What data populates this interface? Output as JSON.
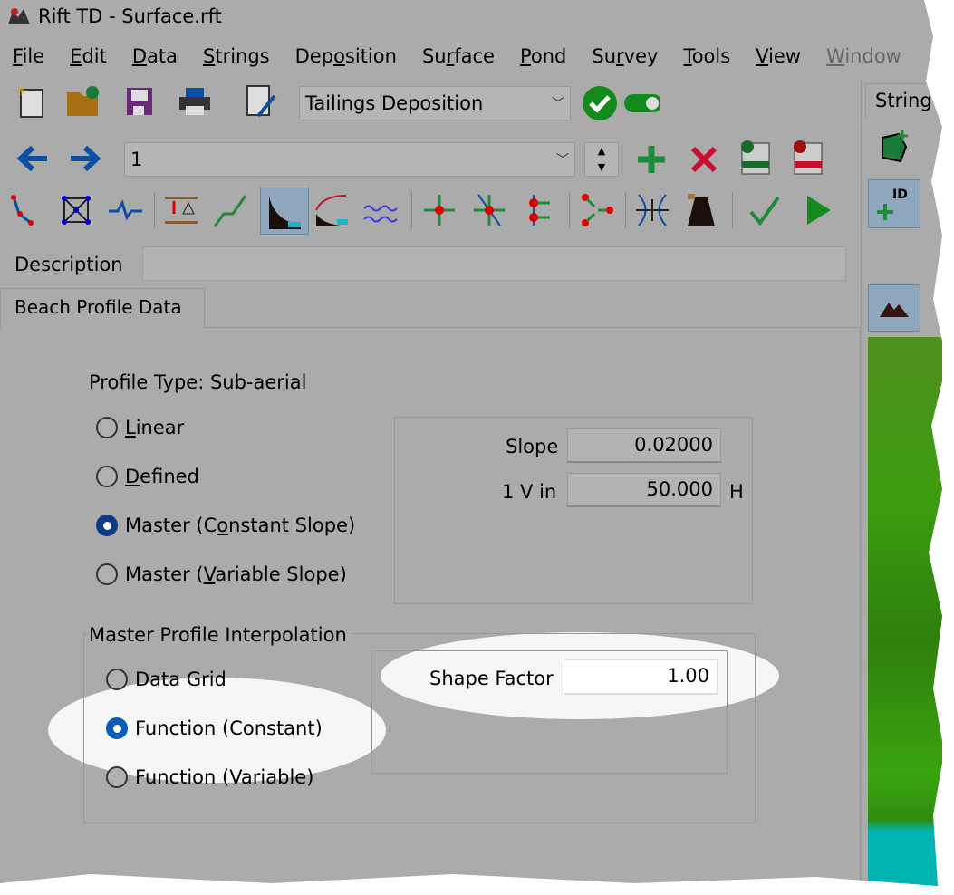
{
  "window": {
    "title": "Rift TD - Surface.rft",
    "app_icon": "rift-td-logo-icon"
  },
  "menu": [
    {
      "pre": "",
      "key": "F",
      "post": "ile"
    },
    {
      "pre": "",
      "key": "E",
      "post": "dit"
    },
    {
      "pre": "",
      "key": "D",
      "post": "ata"
    },
    {
      "pre": "",
      "key": "S",
      "post": "trings"
    },
    {
      "pre": "Dep",
      "key": "o",
      "post": "sition"
    },
    {
      "pre": "Su",
      "key": "r",
      "post": "face"
    },
    {
      "pre": "",
      "key": "P",
      "post": "ond"
    },
    {
      "pre": "Su",
      "key": "r",
      "post": "vey"
    },
    {
      "pre": "",
      "key": "T",
      "post": "ools"
    },
    {
      "pre": "",
      "key": "V",
      "post": "iew"
    },
    {
      "pre": "",
      "key": "W",
      "post": "indow",
      "disabled": true
    }
  ],
  "toolbar": {
    "mode_select": "Tailings Deposition",
    "string_select": "1",
    "row1_icons": [
      "new-file-icon",
      "open-folder-icon",
      "save-icon",
      "print-icon",
      "edit-document-icon",
      "check-circle-icon",
      "toggle-on-icon"
    ],
    "row2_icons": [
      "arrow-left-icon",
      "arrow-right-icon",
      "spin-up-icon",
      "spin-down-icon",
      "add-icon",
      "delete-icon",
      "add-row-grid-icon",
      "delete-row-grid-icon"
    ],
    "row3_icons": [
      "polyline-icon",
      "network-icon",
      "profile-icon",
      "elevation-icon",
      "slope-line-icon",
      "beach-profile-icon",
      "beach-curve-icon",
      "water-icon",
      "move-point-icon",
      "cross-point-icon",
      "split-point-icon",
      "merge-points-icon",
      "intersect-icon",
      "embankment-icon",
      "check-icon",
      "run-icon"
    ]
  },
  "description": {
    "label": "Description",
    "value": ""
  },
  "tab": {
    "label": "Beach Profile Data"
  },
  "profile": {
    "type_label": "Profile Type: Sub-aerial",
    "options": [
      {
        "pre": "",
        "key": "L",
        "post": "inear",
        "selected": false
      },
      {
        "pre": "",
        "key": "D",
        "post": "efined",
        "selected": false
      },
      {
        "pre": "Master (C",
        "key": "o",
        "post": "nstant Slope)",
        "selected": true
      },
      {
        "pre": "Master (",
        "key": "V",
        "post": "ariable Slope)",
        "selected": false
      }
    ],
    "slope_label": "Slope",
    "slope_value": "0.02000",
    "ratio_label": "1 V in",
    "ratio_value": "50.000",
    "ratio_unit": "H"
  },
  "interpolation": {
    "group_label": "Master Profile Interpolation",
    "options": [
      {
        "label": "Data Grid",
        "selected": false
      },
      {
        "label": "Function (Constant)",
        "selected": true
      },
      {
        "label": "Function (Variable)",
        "selected": false
      }
    ],
    "shape_factor_label": "Shape Factor",
    "shape_factor_value": "1.00"
  },
  "right_pane": {
    "tab_label": "String",
    "icons": [
      "add-polygon-icon",
      "add-id-icon",
      "terrain-view-icon"
    ]
  },
  "colors": {
    "accent": "#0c3a86",
    "green": "#1f8a3a",
    "red": "#c8102e",
    "blue": "#0b4fa3"
  }
}
